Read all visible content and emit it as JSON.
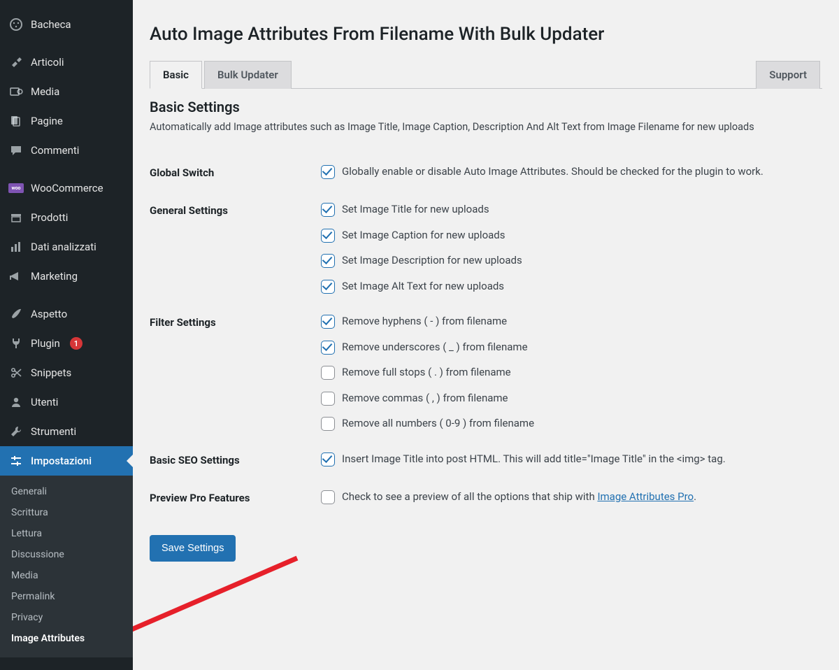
{
  "sidebar": {
    "items": [
      {
        "label": "Bacheca"
      },
      {
        "label": "Articoli"
      },
      {
        "label": "Media"
      },
      {
        "label": "Pagine"
      },
      {
        "label": "Commenti"
      },
      {
        "label": "WooCommerce"
      },
      {
        "label": "Prodotti"
      },
      {
        "label": "Dati analizzati"
      },
      {
        "label": "Marketing"
      },
      {
        "label": "Aspetto"
      },
      {
        "label": "Plugin",
        "badge": "1"
      },
      {
        "label": "Snippets"
      },
      {
        "label": "Utenti"
      },
      {
        "label": "Strumenti"
      },
      {
        "label": "Impostazioni"
      }
    ],
    "submenu": [
      "Generali",
      "Scrittura",
      "Lettura",
      "Discussione",
      "Media",
      "Permalink",
      "Privacy",
      "Image Attributes"
    ]
  },
  "page": {
    "title": "Auto Image Attributes From Filename With Bulk Updater",
    "tabs": {
      "basic": "Basic",
      "bulk": "Bulk Updater",
      "support": "Support"
    },
    "section_title": "Basic Settings",
    "section_desc": "Automatically add Image attributes such as Image Title, Image Caption, Description And Alt Text from Image Filename for new uploads",
    "rows": {
      "global_switch": "Global Switch",
      "general_settings": "General Settings",
      "filter_settings": "Filter Settings",
      "basic_seo": "Basic SEO Settings",
      "preview_pro": "Preview Pro Features"
    },
    "opts": {
      "global": "Globally enable or disable Auto Image Attributes. Should be checked for the plugin to work.",
      "gen1": "Set Image Title for new uploads",
      "gen2": "Set Image Caption for new uploads",
      "gen3": "Set Image Description for new uploads",
      "gen4": "Set Image Alt Text for new uploads",
      "flt1": "Remove hyphens ( - ) from filename",
      "flt2": "Remove underscores ( _ ) from filename",
      "flt3": "Remove full stops ( . ) from filename",
      "flt4": "Remove commas ( , ) from filename",
      "flt5": "Remove all numbers ( 0-9 ) from filename",
      "seo1": "Insert Image Title into post HTML. This will add title=\"Image Title\" in the <img> tag.",
      "prev_prefix": "Check to see a preview of all the options that ship with ",
      "prev_link": "Image Attributes Pro",
      "prev_suffix": "."
    },
    "save": "Save Settings"
  }
}
